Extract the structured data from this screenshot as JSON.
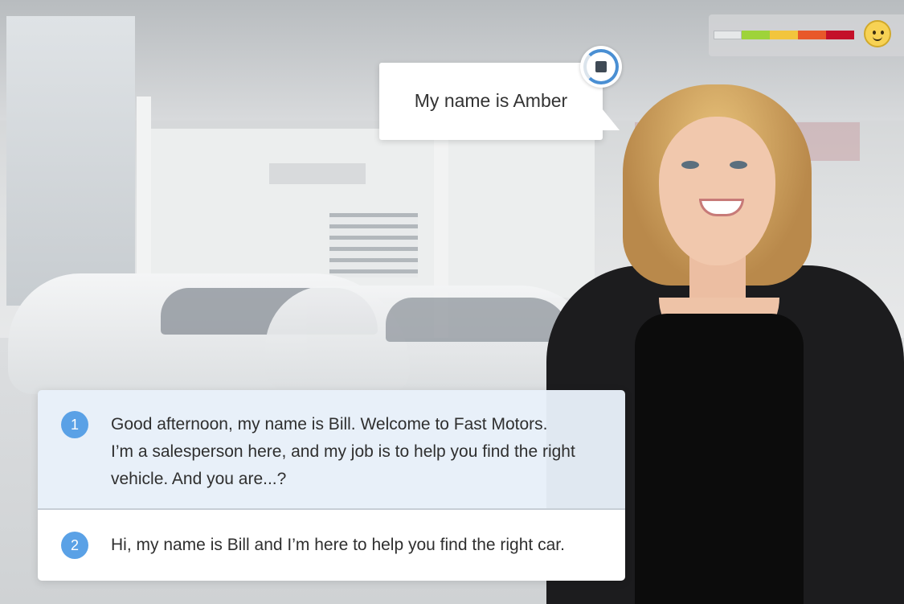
{
  "avatar": {
    "speech": "My name is Amber"
  },
  "mood_meter": {
    "segment_colors": [
      "#e6e8e9",
      "#9ed33a",
      "#f2c53d",
      "#e8582a",
      "#c4102a"
    ],
    "face_icon": "smiley-face-icon"
  },
  "stop_button": {
    "icon": "stop-icon",
    "accent": "#4a8fd3"
  },
  "responses": [
    {
      "number": "1",
      "lines": [
        "Good afternoon, my name is Bill. Welcome to Fast Motors.",
        "I’m a salesperson here, and my job is to help you find the right",
        "vehicle. And you are...?"
      ]
    },
    {
      "number": "2",
      "lines": [
        "Hi, my name is Bill and I’m here to help you find the right car."
      ]
    }
  ]
}
